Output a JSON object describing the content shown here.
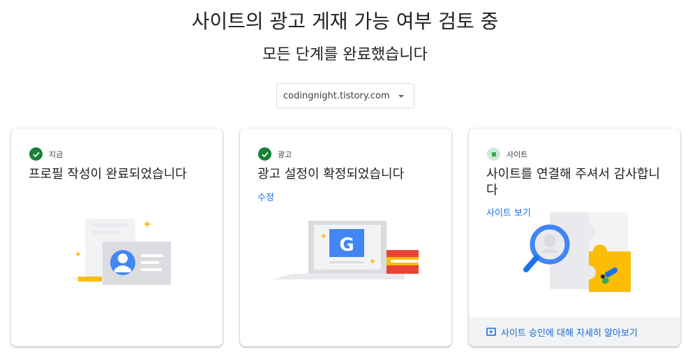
{
  "page": {
    "title": "사이트의 광고 게재 가능 여부 검토 중",
    "subtitle": "모든 단계를 완료했습니다"
  },
  "site_selector": {
    "value": "codingnight.tistory.com"
  },
  "cards": [
    {
      "step_label": "지금",
      "status": "complete",
      "title": "프로필 작성이 완료되었습니다",
      "illustration": "profile-card-illustration"
    },
    {
      "step_label": "광고",
      "status": "complete",
      "title": "광고 설정이 확정되었습니다",
      "link": "수정",
      "illustration": "laptop-google-illustration"
    },
    {
      "step_label": "사이트",
      "status": "pending",
      "title": "사이트를 연결해 주셔서 감사합니다",
      "link": "사이트 보기",
      "illustration": "puzzle-magnifier-illustration",
      "footer_link": "사이트 승인에 대해 자세히 알아보기"
    }
  ],
  "colors": {
    "check_green": "#188038",
    "pending_bg": "#ceead6",
    "link_blue": "#1a73e8",
    "footer_bg": "#f1f3f4",
    "accent_yellow": "#fbbc04",
    "google_blue": "#4285f4"
  }
}
